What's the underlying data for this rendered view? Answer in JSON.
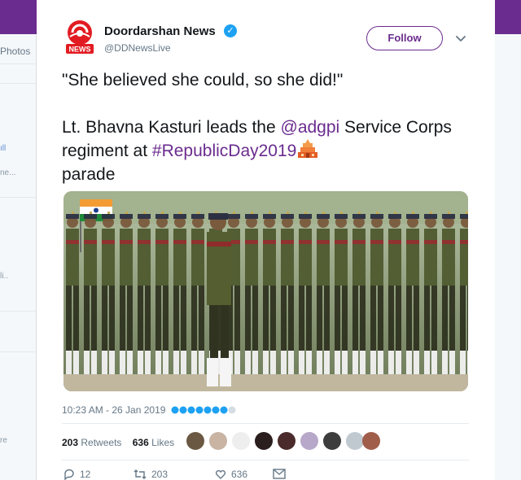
{
  "background": {
    "tab_fragment": "Photos",
    "fragments": [
      "ıll",
      "ne...",
      "li..",
      "re"
    ]
  },
  "tweet": {
    "user_name": "Doordarshan News",
    "handle": "@DDNewsLive",
    "avatar_logo_text": "NEWS",
    "follow_label": "Follow",
    "quote": "\"She believed she could, so she did!\"",
    "text_before": "Lt. Bhavna Kasturi leads the ",
    "mention": "@adgpi",
    "text_middle": " Service Corps regiment at ",
    "hashtag": "#RepublicDay2019",
    "text_after": "parade",
    "timestamp": "10:23 AM - 26 Jan 2019",
    "retweets_count": "203",
    "retweets_label": "Retweets",
    "likes_count": "636",
    "likes_label": "Likes",
    "actions": {
      "reply_count": "12",
      "retweet_count": "203",
      "like_count": "636"
    }
  },
  "colors": {
    "brand": "#6a2c8e",
    "verified": "#1da1f2",
    "muted": "#657786"
  },
  "icons": [
    "doordarshan-logo-icon",
    "verified-icon",
    "chevron-down-icon",
    "temple-emoji-icon",
    "reply-icon",
    "retweet-icon",
    "like-icon",
    "dm-icon"
  ]
}
